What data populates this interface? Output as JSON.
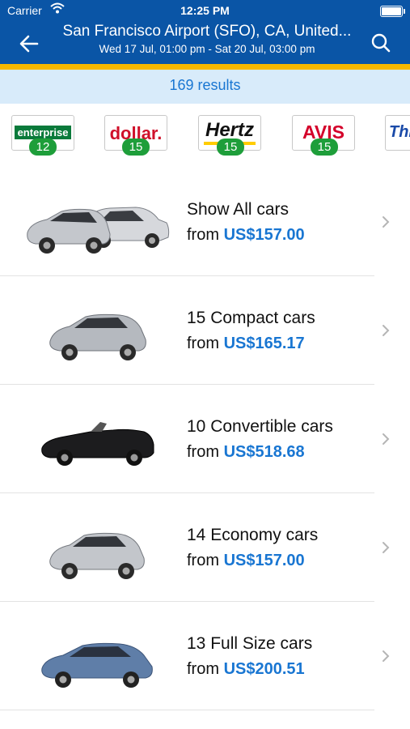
{
  "status_bar": {
    "carrier": "Carrier",
    "time": "12:25 PM"
  },
  "header": {
    "title": "San Francisco Airport (SFO), CA, United...",
    "subtitle": "Wed 17 Jul, 01:00 pm - Sat 20 Jul, 03:00 pm",
    "back_icon": "back-arrow-icon",
    "search_icon": "search-icon"
  },
  "results": {
    "label": "169 results"
  },
  "brands": [
    {
      "name": "enterprise",
      "count": "12"
    },
    {
      "name": "dollar.",
      "count": "15"
    },
    {
      "name": "Hertz",
      "count": "15"
    },
    {
      "name": "AVIS",
      "count": "15"
    },
    {
      "name": "Thr",
      "count": ""
    }
  ],
  "cars": [
    {
      "name": "Show All cars",
      "from": "from",
      "price": "US$157.00",
      "color": "#b8bcc2"
    },
    {
      "name": "15 Compact cars",
      "from": "from",
      "price": "US$165.17",
      "color": "#b5b9bf"
    },
    {
      "name": "10 Convertible cars",
      "from": "from",
      "price": "US$518.68",
      "color": "#1c1c1e"
    },
    {
      "name": "14 Economy cars",
      "from": "from",
      "price": "US$157.00",
      "color": "#c3c6cb"
    },
    {
      "name": "13 Full Size cars",
      "from": "from",
      "price": "US$200.51",
      "color": "#5f7ea8"
    }
  ],
  "colors": {
    "header": "#0a55a6",
    "accent": "#f5b800",
    "results_bg": "#d8ebfa",
    "price": "#1976d2",
    "badge": "#1e9e3a"
  }
}
